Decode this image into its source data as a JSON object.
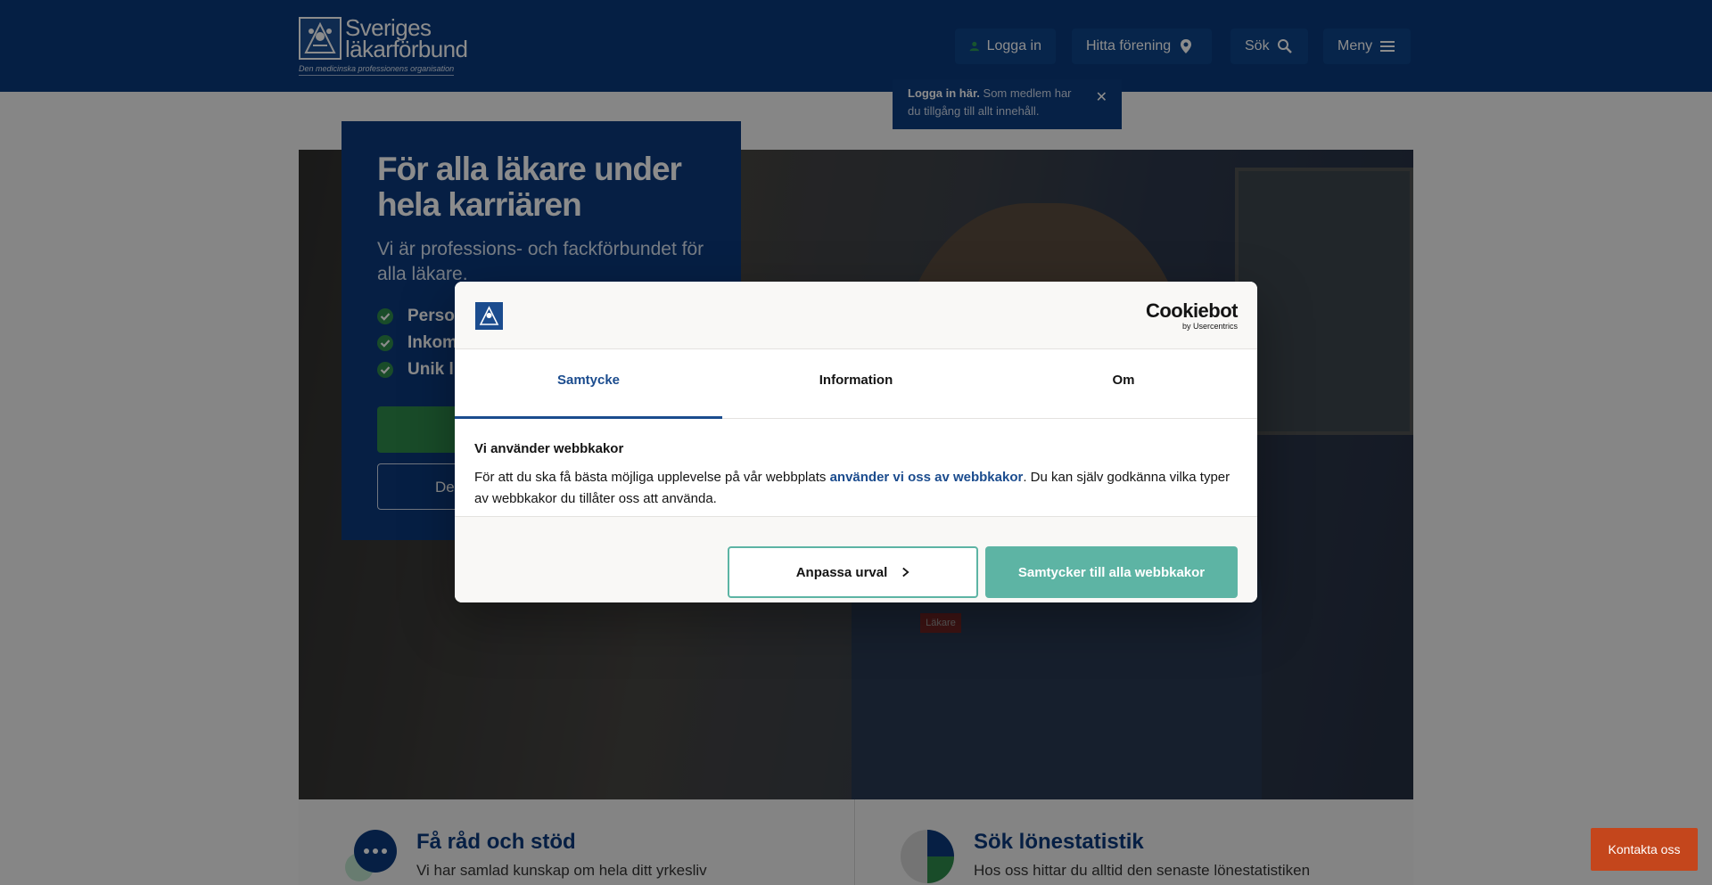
{
  "header": {
    "logo_name_line1": "Sveriges",
    "logo_name_line2": "läkarförbund",
    "logo_tagline": "Den medicinska professionens organisation",
    "nav": {
      "login": "Logga in",
      "find": "Hitta förening",
      "search": "Sök",
      "menu": "Meny"
    }
  },
  "tooltip": {
    "bold": "Logga in här.",
    "text": " Som medlem har du tillgång till allt innehåll.",
    "close": "✕"
  },
  "hero": {
    "title": "För alla läkare under hela karriären",
    "lead": "Vi är professions- och fackförbundet för alla läkare.",
    "bullets": [
      "Perso",
      "Inkom",
      "Unik l"
    ],
    "secondary_button": "De",
    "image_badge": "Läkare"
  },
  "cards": [
    {
      "title": "Få råd och stöd",
      "text": "Vi har samlad kunskap om hela ditt yrkesliv"
    },
    {
      "title": "Sök lönestatistik",
      "text": "Hos oss hittar du alltid den senaste lönestatistiken"
    }
  ],
  "contact_button": "Kontakta oss",
  "cookie_dialog": {
    "brand": "Cookiebot",
    "brand_sub": "by Usercentrics",
    "tabs": [
      "Samtycke",
      "Information",
      "Om"
    ],
    "active_tab": "Samtycke",
    "heading": "Vi använder webbkakor",
    "text_before": "För att du ska få bästa möjliga upplevelse på vår webbplats ",
    "link": "använder vi oss av webbkakor",
    "text_after": ". Du kan själv godkänna vilka typer av webbkakor du tillåter oss att använda.",
    "customize_button": "Anpassa urval",
    "accept_button": "Samtycker till alla webbkakor"
  },
  "colors": {
    "brand_blue": "#0a3a7c",
    "accept_teal": "#5db4a4",
    "contact_orange": "#c4461c",
    "check_green": "#2e8a4b"
  }
}
